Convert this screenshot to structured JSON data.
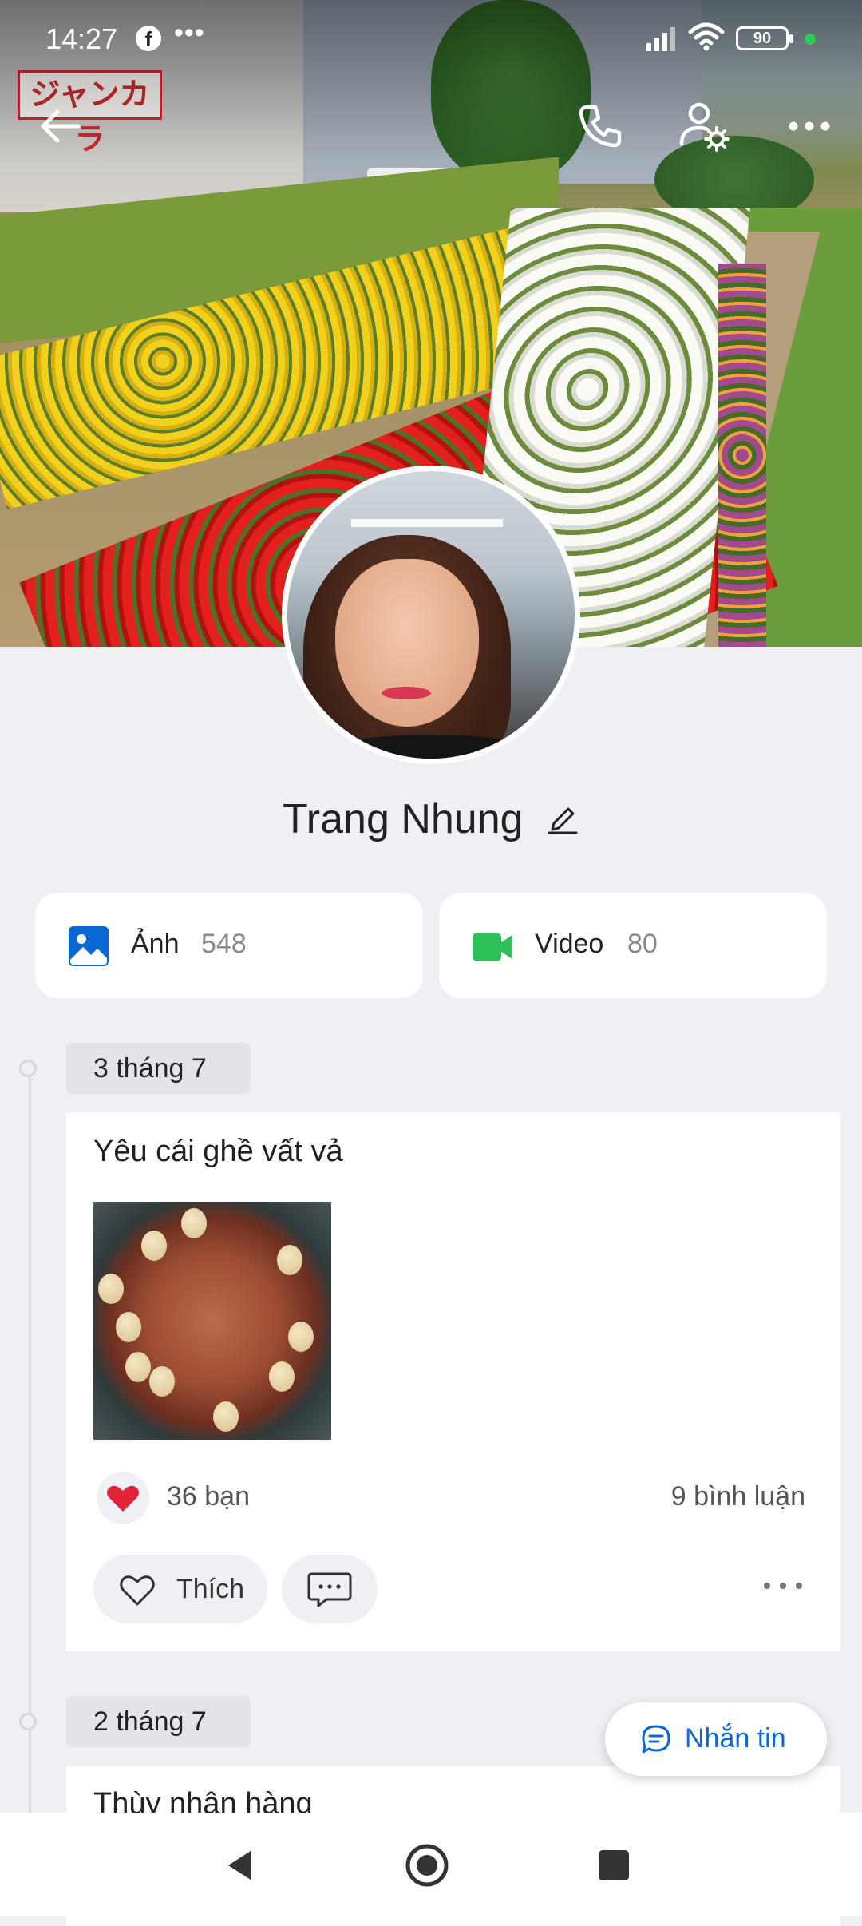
{
  "status_bar": {
    "time": "14:27",
    "notif_dots": "•••",
    "battery": "90"
  },
  "top_bar": {
    "icons": [
      "back-arrow-icon",
      "phone-icon",
      "user-settings-icon",
      "more-icon"
    ]
  },
  "profile": {
    "name": "Trang Nhung"
  },
  "media": {
    "photos": {
      "label": "Ảnh",
      "count": "548",
      "color": "#0a68d4"
    },
    "videos": {
      "label": "Video",
      "count": "80",
      "color": "#2fbf5a"
    }
  },
  "timeline": [
    {
      "date": "3 tháng 7",
      "caption": "Yêu cái ghề vất vả",
      "likes": "36 bạn",
      "comments": "9 bình luận",
      "like_label": "Thích"
    },
    {
      "date": "2 tháng 7",
      "caption": "Thùy nhận hàng"
    }
  ],
  "fab": {
    "label": "Nhắn tin",
    "accent": "#0a68d4"
  },
  "nav": {
    "icons": [
      "back-triangle-icon",
      "home-circle-icon",
      "recents-square-icon"
    ]
  }
}
